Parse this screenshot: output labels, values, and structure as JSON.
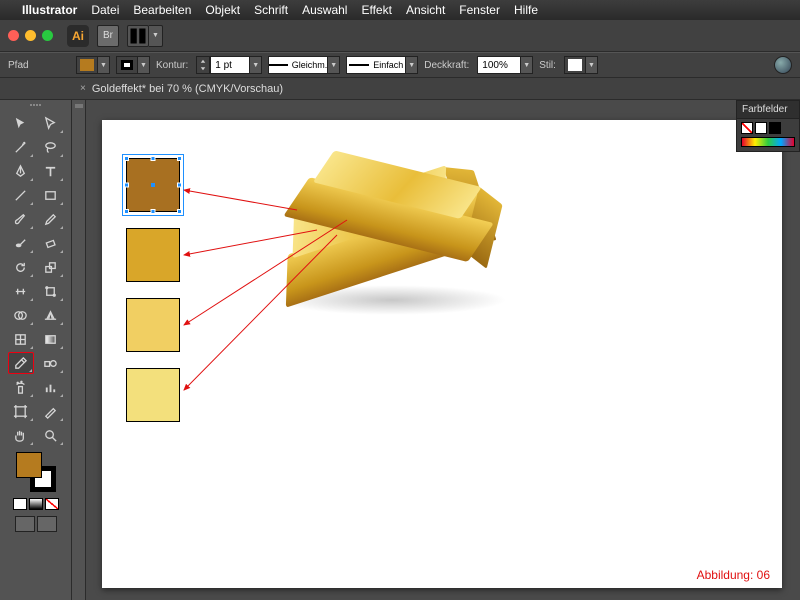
{
  "mac_menu": {
    "apple": "",
    "app": "Illustrator",
    "items": [
      "Datei",
      "Bearbeiten",
      "Objekt",
      "Schrift",
      "Auswahl",
      "Effekt",
      "Ansicht",
      "Fenster",
      "Hilfe"
    ]
  },
  "titlebar": {
    "app_badge": "Ai",
    "br_badge": "Br"
  },
  "control_bar": {
    "object_type": "Pfad",
    "stroke_label": "Kontur:",
    "stroke_weight": "1 pt",
    "dash_profile_1": "Gleichm.",
    "dash_profile_2": "Einfach",
    "opacity_label": "Deckkraft:",
    "opacity_value": "100%",
    "style_label": "Stil:",
    "fill_color": "#b57b1f",
    "stroke_color": "#000000"
  },
  "document": {
    "tab_title": "Goldeffekt* bei 70 % (CMYK/Vorschau)"
  },
  "tools": {
    "fill_color": "#b57b1f",
    "stroke_color": "#000000"
  },
  "artboard": {
    "swatches": [
      {
        "color": "#a87021",
        "selected": true
      },
      {
        "color": "#d9a629",
        "selected": false
      },
      {
        "color": "#f1cf62",
        "selected": false
      },
      {
        "color": "#f3e07c",
        "selected": false
      }
    ],
    "caption": "Abbildung: 06"
  },
  "right_panel": {
    "title": "Farbfelder"
  }
}
